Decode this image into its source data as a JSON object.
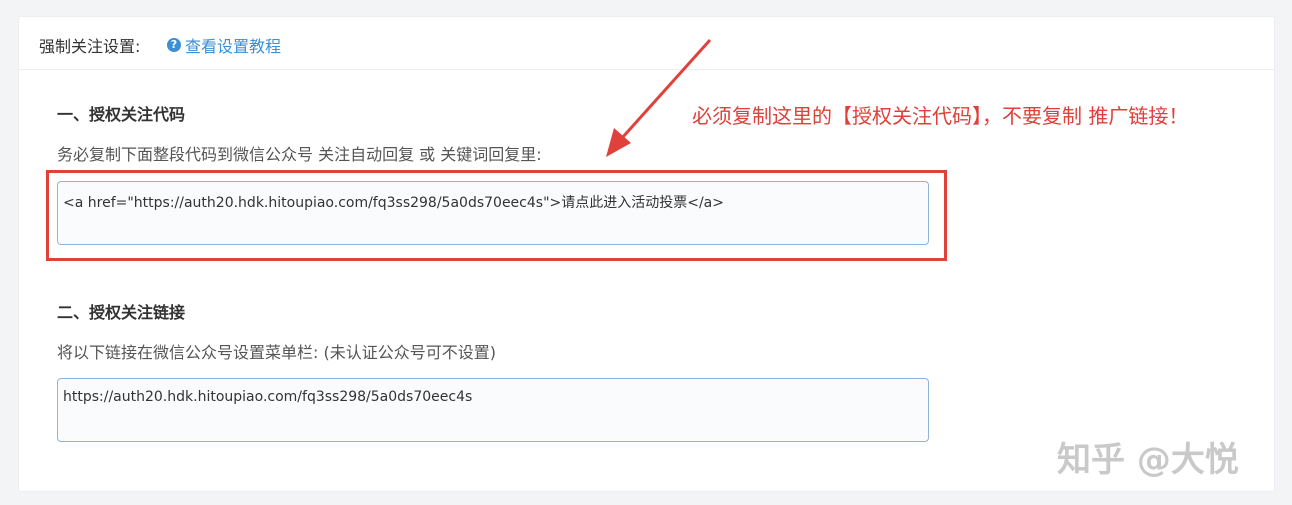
{
  "header": {
    "label": "强制关注设置:",
    "tutorial_link": "查看设置教程",
    "help_icon": "question-circle-icon"
  },
  "section1": {
    "title": "一、授权关注代码",
    "description": "务必复制下面整段代码到微信公众号 关注自动回复 或 关键词回复里:",
    "code": "<a href=\"https://auth20.hdk.hitoupiao.com/fq3ss298/5a0ds70eec4s\">请点此进入活动投票</a>"
  },
  "section2": {
    "title": "二、授权关注链接",
    "description": "将以下链接在微信公众号设置菜单栏: (未认证公众号可不设置)",
    "link": "https://auth20.hdk.hitoupiao.com/fq3ss298/5a0ds70eec4s"
  },
  "annotation": {
    "text": "必须复制这里的【授权关注代码】，不要复制 推广链接！",
    "color": "#e0403a"
  },
  "watermark": "知乎 @大悦",
  "colors": {
    "link": "#3b8fd5",
    "highlight": "#e0423b",
    "input_border": "#8fb4d8"
  }
}
